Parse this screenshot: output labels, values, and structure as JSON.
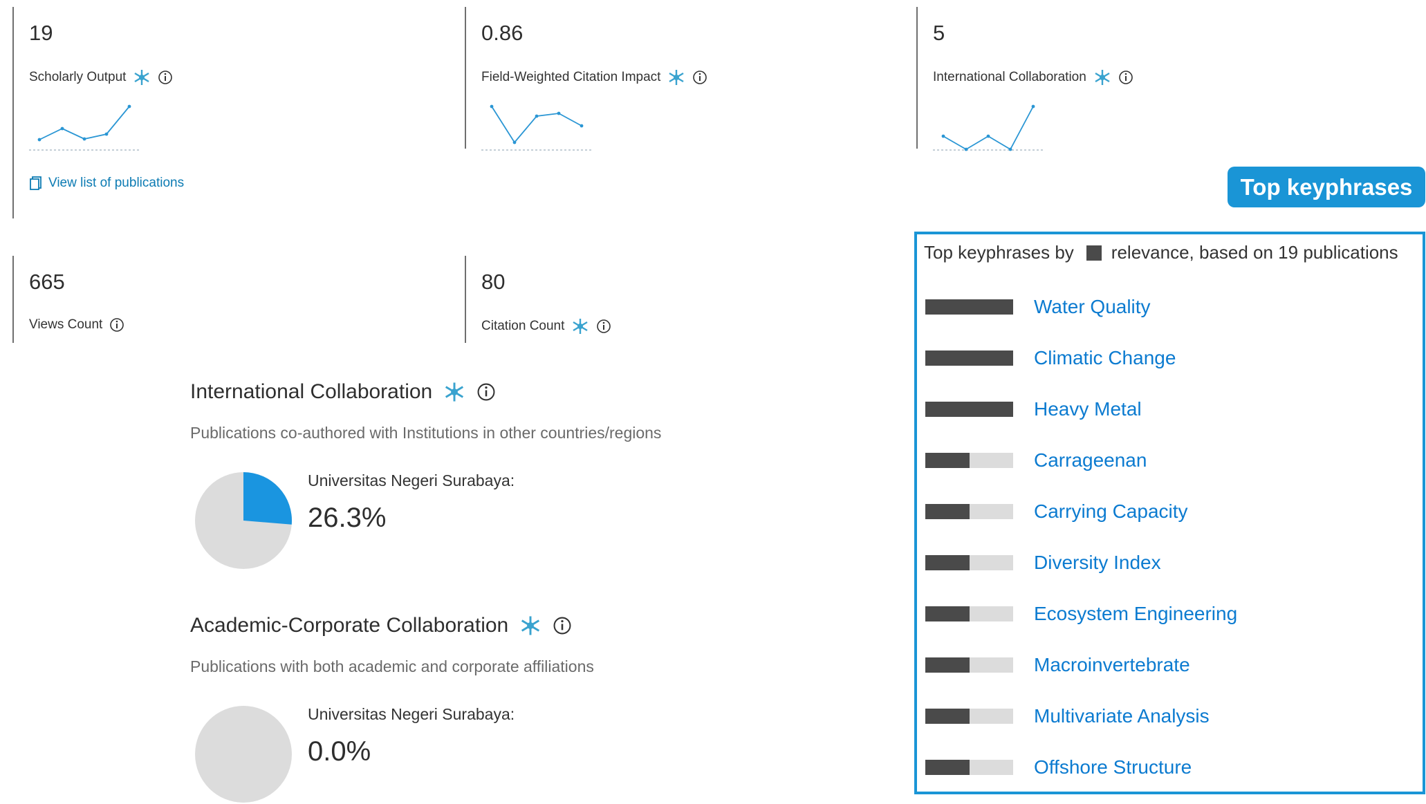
{
  "metrics": {
    "scholarly_output": {
      "value": "19",
      "label": "Scholarly Output"
    },
    "fwci": {
      "value": "0.86",
      "label": "Field-Weighted Citation Impact"
    },
    "intl_collab": {
      "value": "5",
      "label": "International Collaboration"
    },
    "views": {
      "value": "665",
      "label": "Views Count"
    },
    "citations": {
      "value": "80",
      "label": "Citation Count"
    }
  },
  "view_list_link": "View list of publications",
  "international_collaboration": {
    "title": "International Collaboration",
    "subtitle": "Publications co-authored with Institutions in other countries/regions",
    "institution": "Universitas Negeri Surabaya:",
    "percent": "26.3%",
    "fraction": 0.263
  },
  "academic_corporate": {
    "title": "Academic-Corporate Collaboration",
    "subtitle": "Publications with both academic and corporate affiliations",
    "institution": "Universitas Negeri Surabaya:",
    "percent": "0.0%",
    "fraction": 0.0
  },
  "keyphrases": {
    "badge": "Top keyphrases",
    "header_prefix": "Top keyphrases by",
    "header_suffix": "relevance, based on 19 publications",
    "items": [
      {
        "label": "Water Quality",
        "relevance": 1.0
      },
      {
        "label": "Climatic Change",
        "relevance": 1.0
      },
      {
        "label": "Heavy Metal",
        "relevance": 1.0
      },
      {
        "label": "Carrageenan",
        "relevance": 0.5
      },
      {
        "label": "Carrying Capacity",
        "relevance": 0.5
      },
      {
        "label": "Diversity Index",
        "relevance": 0.5
      },
      {
        "label": "Ecosystem Engineering",
        "relevance": 0.5
      },
      {
        "label": "Macroinvertebrate",
        "relevance": 0.5
      },
      {
        "label": "Multivariate Analysis",
        "relevance": 0.5
      },
      {
        "label": "Offshore Structure",
        "relevance": 0.5
      }
    ]
  },
  "colors": {
    "accent": "#1a95d6",
    "link": "#0c7bd0",
    "bar_dark": "#4a4a4a",
    "bar_light": "#dcdcdc",
    "pie_gray": "#dcdcdc"
  }
}
